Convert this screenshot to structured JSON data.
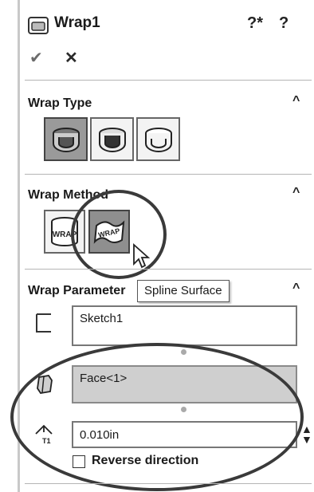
{
  "header": {
    "title": "Wrap1",
    "help_labels": [
      "?*",
      "?"
    ],
    "ok_label": "✔",
    "cancel_label": "✕"
  },
  "sections": {
    "wrap_type": {
      "title": "Wrap Type"
    },
    "wrap_method": {
      "title": "Wrap Method"
    },
    "wrap_parameters": {
      "title": "Wrap Parameter",
      "tooltip": "Spline Surface"
    }
  },
  "params": {
    "sketch": "Sketch1",
    "face": "Face<1>",
    "thickness": "0.010in",
    "reverse_label": "Reverse direction"
  },
  "collapse_glyph": "^",
  "method_labels": [
    "WRAP",
    "WRAP"
  ]
}
